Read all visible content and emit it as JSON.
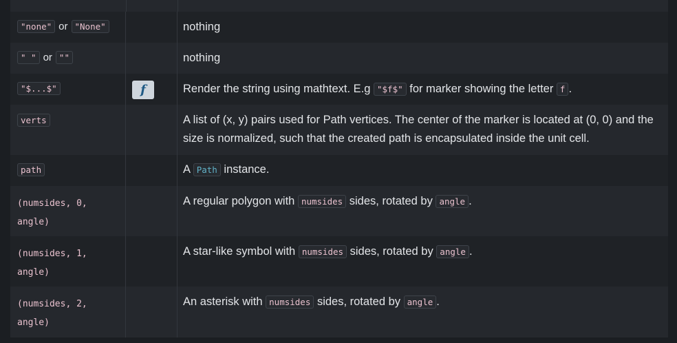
{
  "rows": [
    {
      "marker_a": "\"none\"",
      "sep": "or",
      "marker_b": "\"None\"",
      "description": "nothing"
    },
    {
      "marker_a": "\" \"",
      "sep": "or",
      "marker_b": "\"\"",
      "description": "nothing"
    },
    {
      "marker": "\"$...$\"",
      "preview_icon": "math-f-icon",
      "preview_glyph": "f",
      "desc_pre": "Render the string using mathtext. E.g",
      "desc_code": "\"$f$\"",
      "desc_mid": "for marker showing the letter",
      "desc_code2": "f",
      "desc_post": "."
    },
    {
      "marker": "verts",
      "description": "A list of (x, y) pairs used for Path vertices. The center of the marker is located at (0, 0) and the size is normalized, such that the created path is encapsulated inside the unit cell."
    },
    {
      "marker": "path",
      "desc_pre": "A",
      "desc_link": "Path",
      "desc_post": "instance."
    },
    {
      "marker_line1": "(numsides, 0,",
      "marker_line2": "angle)",
      "desc_pre": "A regular polygon with",
      "desc_code": "numsides",
      "desc_mid": "sides, rotated by",
      "desc_code2": "angle",
      "desc_post": "."
    },
    {
      "marker_line1": "(numsides, 1,",
      "marker_line2": "angle)",
      "desc_pre": "A star-like symbol with",
      "desc_code": "numsides",
      "desc_mid": "sides, rotated by",
      "desc_code2": "angle",
      "desc_post": "."
    },
    {
      "marker_line1": "(numsides, 2,",
      "marker_line2": "angle)",
      "desc_pre": "An asterisk with",
      "desc_code": "numsides",
      "desc_mid": "sides, rotated by",
      "desc_code2": "angle",
      "desc_post": "."
    }
  ]
}
